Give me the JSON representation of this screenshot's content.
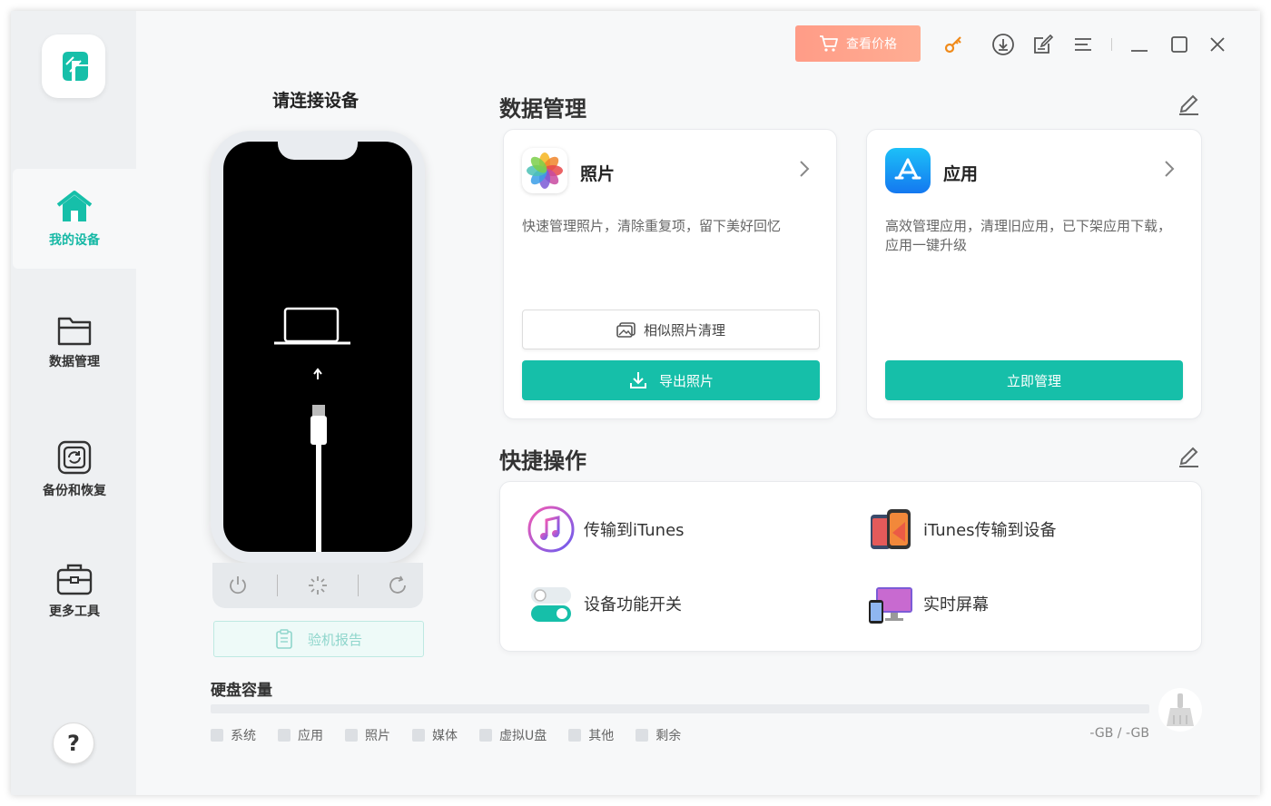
{
  "sidebar": {
    "items": [
      {
        "label": "我的设备",
        "icon": "home-icon",
        "active": true
      },
      {
        "label": "数据管理",
        "icon": "folder-icon",
        "active": false
      },
      {
        "label": "备份和恢复",
        "icon": "backup-icon",
        "active": false
      },
      {
        "label": "更多工具",
        "icon": "toolbox-icon",
        "active": false
      }
    ],
    "help": "?"
  },
  "topbar": {
    "price_label": "查看价格"
  },
  "device": {
    "title": "请连接设备",
    "report_label": "验机报告"
  },
  "data_mgmt": {
    "title": "数据管理",
    "photos": {
      "title": "照片",
      "desc": "快速管理照片，清除重复项，留下美好回忆",
      "similar_label": "相似照片清理",
      "export_label": "导出照片"
    },
    "apps": {
      "title": "应用",
      "desc": "高效管理应用，清理旧应用，已下架应用下载，应用一键升级",
      "manage_label": "立即管理"
    }
  },
  "quick": {
    "title": "快捷操作",
    "items": [
      {
        "label": "传输到iTunes"
      },
      {
        "label": "iTunes传输到设备"
      },
      {
        "label": "设备功能开关"
      },
      {
        "label": "实时屏幕"
      }
    ]
  },
  "disk": {
    "title": "硬盘容量",
    "legend": [
      "系统",
      "应用",
      "照片",
      "媒体",
      "虚拟U盘",
      "其他",
      "剩余"
    ],
    "value": "-GB / -GB",
    "used_fraction": 0
  },
  "colors": {
    "accent": "#16bfa9",
    "price": "#ffa18c"
  }
}
